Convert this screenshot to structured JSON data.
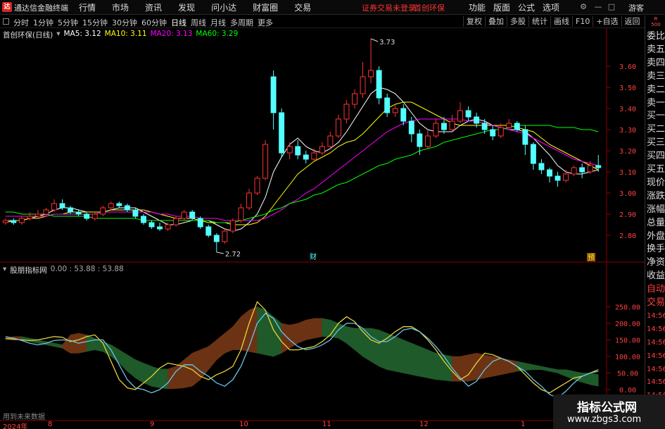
{
  "titlebar": {
    "app_name": "通达信金融终端",
    "menu": [
      "行情",
      "市场",
      "资讯",
      "发现",
      "问小达",
      "财富圈",
      "交易"
    ],
    "login_status": "证券交易未登录",
    "stock_name": "首创环保",
    "right_menu": [
      "功能",
      "版面",
      "公式",
      "选项"
    ],
    "guest": "游客"
  },
  "toolbar": {
    "periods": [
      "分时",
      "1分钟",
      "5分钟",
      "15分钟",
      "30分钟",
      "60分钟",
      "日线",
      "周线",
      "月线",
      "多周期",
      "更多"
    ],
    "active_period": "日线",
    "tools": [
      "复权",
      "叠加",
      "多股",
      "统计",
      "画线",
      "F10",
      "+自选",
      "返回"
    ]
  },
  "legend": {
    "title": "首创环保(日线)",
    "ma5": "MA5: 3.12",
    "ma10": "MA10: 3.11",
    "ma20": "MA20: 3.13",
    "ma60": "MA60: 3.29"
  },
  "indicator_legend": {
    "title": "股朋指标网",
    "values": "0.00 : 53.88 : 53.88"
  },
  "future_text": "用到未来数据",
  "price_axis": [
    "3.60",
    "3.50",
    "3.40",
    "3.30",
    "3.20",
    "3.10",
    "3.00",
    "2.90",
    "2.80"
  ],
  "indicator_axis": [
    "250.00",
    "200.00",
    "150.00",
    "100.00",
    "50.00",
    "0.00"
  ],
  "annotations": {
    "high": "3.73",
    "low": "2.72",
    "cai": "财",
    "yu": "预"
  },
  "date_axis": [
    "2024年",
    "8",
    "9",
    "10",
    "11",
    "12",
    "1"
  ],
  "sidebar": {
    "badge": "R\n500",
    "items": [
      "委比",
      "卖五",
      "卖四",
      "卖三",
      "卖二",
      "卖一",
      "买一",
      "买二",
      "买三",
      "买四",
      "买五",
      "现价",
      "涨跌",
      "涨幅",
      "总量",
      "外盘",
      "换手",
      "净资",
      "收益",
      "自动",
      "交易",
      "14:56",
      "14:56",
      "14:56",
      "14:56",
      "14:56",
      "14:56",
      "14:56",
      "14:56",
      "14:56"
    ]
  },
  "watermark": {
    "line1": "指标公式网",
    "line2": "www.zbgs3.com"
  },
  "colors": {
    "up": "#ff3232",
    "down": "#54ffff",
    "ma5": "#ffffff",
    "ma10": "#ffff00",
    "ma20": "#ff00ff",
    "ma60": "#00ff00",
    "band_up": "#6b3313",
    "band_down": "#1f5a2a",
    "line_yellow": "#e8d33a",
    "line_blue": "#6bc4e8"
  },
  "chart_data": [
    {
      "type": "candlestick",
      "title": "首创环保(日线)",
      "ylim": [
        2.72,
        3.73
      ],
      "y_ticks": [
        2.8,
        2.9,
        3.0,
        3.1,
        3.2,
        3.3,
        3.4,
        3.5,
        3.6
      ],
      "x_ticks": [
        "2024年",
        "8",
        "9",
        "10",
        "11",
        "12",
        "1"
      ],
      "candles": [
        [
          2.86,
          2.87,
          2.88,
          2.85
        ],
        [
          2.87,
          2.86,
          2.88,
          2.85
        ],
        [
          2.86,
          2.88,
          2.89,
          2.85
        ],
        [
          2.88,
          2.89,
          2.91,
          2.87
        ],
        [
          2.89,
          2.9,
          2.92,
          2.88
        ],
        [
          2.9,
          2.92,
          2.93,
          2.89
        ],
        [
          2.92,
          2.95,
          2.97,
          2.91
        ],
        [
          2.95,
          2.93,
          2.97,
          2.92
        ],
        [
          2.93,
          2.91,
          2.94,
          2.9
        ],
        [
          2.91,
          2.9,
          2.92,
          2.89
        ],
        [
          2.9,
          2.88,
          2.91,
          2.87
        ],
        [
          2.88,
          2.9,
          2.91,
          2.87
        ],
        [
          2.9,
          2.93,
          2.94,
          2.89
        ],
        [
          2.93,
          2.95,
          2.96,
          2.92
        ],
        [
          2.95,
          2.94,
          2.96,
          2.93
        ],
        [
          2.94,
          2.92,
          2.95,
          2.91
        ],
        [
          2.92,
          2.89,
          2.93,
          2.88
        ],
        [
          2.89,
          2.86,
          2.9,
          2.85
        ],
        [
          2.86,
          2.84,
          2.87,
          2.83
        ],
        [
          2.84,
          2.83,
          2.86,
          2.82
        ],
        [
          2.83,
          2.85,
          2.86,
          2.82
        ],
        [
          2.85,
          2.88,
          2.89,
          2.84
        ],
        [
          2.88,
          2.91,
          2.92,
          2.87
        ],
        [
          2.91,
          2.88,
          2.92,
          2.87
        ],
        [
          2.88,
          2.84,
          2.89,
          2.83
        ],
        [
          2.84,
          2.8,
          2.85,
          2.79
        ],
        [
          2.8,
          2.77,
          2.81,
          2.72
        ],
        [
          2.77,
          2.82,
          2.83,
          2.76
        ],
        [
          2.82,
          2.87,
          2.88,
          2.81
        ],
        [
          2.87,
          2.93,
          2.95,
          2.86
        ],
        [
          2.93,
          3.0,
          3.02,
          2.92
        ],
        [
          3.0,
          3.07,
          3.08,
          2.99
        ],
        [
          3.07,
          3.23,
          3.25,
          3.06
        ],
        [
          3.55,
          3.38,
          3.58,
          3.3
        ],
        [
          3.38,
          3.19,
          3.4,
          3.17
        ],
        [
          3.19,
          3.22,
          3.24,
          3.16
        ],
        [
          3.22,
          3.18,
          3.25,
          3.16
        ],
        [
          3.18,
          3.16,
          3.2,
          3.14
        ],
        [
          3.16,
          3.19,
          3.21,
          3.15
        ],
        [
          3.19,
          3.22,
          3.24,
          3.18
        ],
        [
          3.22,
          3.27,
          3.29,
          3.21
        ],
        [
          3.27,
          3.35,
          3.37,
          3.26
        ],
        [
          3.35,
          3.42,
          3.44,
          3.33
        ],
        [
          3.42,
          3.47,
          3.49,
          3.4
        ],
        [
          3.47,
          3.55,
          3.62,
          3.45
        ],
        [
          3.55,
          3.58,
          3.73,
          3.52
        ],
        [
          3.58,
          3.45,
          3.6,
          3.42
        ],
        [
          3.45,
          3.38,
          3.47,
          3.36
        ],
        [
          3.38,
          3.4,
          3.42,
          3.36
        ],
        [
          3.4,
          3.34,
          3.42,
          3.32
        ],
        [
          3.34,
          3.28,
          3.36,
          3.24
        ],
        [
          3.28,
          3.22,
          3.3,
          3.18
        ],
        [
          3.22,
          3.27,
          3.3,
          3.21
        ],
        [
          3.27,
          3.33,
          3.35,
          3.26
        ],
        [
          3.33,
          3.3,
          3.36,
          3.28
        ],
        [
          3.3,
          3.34,
          3.37,
          3.29
        ],
        [
          3.34,
          3.39,
          3.43,
          3.33
        ],
        [
          3.39,
          3.36,
          3.41,
          3.34
        ],
        [
          3.36,
          3.33,
          3.38,
          3.31
        ],
        [
          3.33,
          3.3,
          3.35,
          3.28
        ],
        [
          3.3,
          3.27,
          3.32,
          3.25
        ],
        [
          3.27,
          3.31,
          3.33,
          3.26
        ],
        [
          3.31,
          3.33,
          3.35,
          3.3
        ],
        [
          3.33,
          3.3,
          3.34,
          3.29
        ],
        [
          3.3,
          3.23,
          3.32,
          3.18
        ],
        [
          3.23,
          3.14,
          3.24,
          3.11
        ],
        [
          3.14,
          3.11,
          3.16,
          3.09
        ],
        [
          3.11,
          3.08,
          3.12,
          3.05
        ],
        [
          3.08,
          3.06,
          3.1,
          3.03
        ],
        [
          3.06,
          3.09,
          3.11,
          3.05
        ],
        [
          3.09,
          3.12,
          3.13,
          3.08
        ],
        [
          3.12,
          3.1,
          3.14,
          3.07
        ],
        [
          3.1,
          3.13,
          3.15,
          3.09
        ],
        [
          3.13,
          3.12,
          3.18,
          3.1
        ]
      ],
      "series": [
        {
          "name": "MA5",
          "values": [
            2.86,
            2.87,
            2.87,
            2.88,
            2.89,
            2.9,
            2.92,
            2.93,
            2.93,
            2.92,
            2.91,
            2.91,
            2.91,
            2.92,
            2.93,
            2.93,
            2.93,
            2.91,
            2.89,
            2.87,
            2.85,
            2.85,
            2.86,
            2.87,
            2.87,
            2.87,
            2.85,
            2.83,
            2.82,
            2.83,
            2.86,
            2.9,
            2.98,
            3.1,
            3.17,
            3.23,
            3.26,
            3.22,
            3.2,
            3.19,
            3.21,
            3.24,
            3.29,
            3.35,
            3.41,
            3.47,
            3.5,
            3.49,
            3.47,
            3.43,
            3.38,
            3.33,
            3.3,
            3.29,
            3.29,
            3.29,
            3.32,
            3.34,
            3.35,
            3.34,
            3.32,
            3.31,
            3.3,
            3.3,
            3.29,
            3.26,
            3.22,
            3.18,
            3.13,
            3.1,
            3.09,
            3.09,
            3.1,
            3.11
          ]
        },
        {
          "name": "MA10",
          "values": [
            2.87,
            2.87,
            2.87,
            2.88,
            2.88,
            2.89,
            2.9,
            2.9,
            2.91,
            2.91,
            2.91,
            2.91,
            2.91,
            2.92,
            2.92,
            2.92,
            2.92,
            2.92,
            2.91,
            2.9,
            2.89,
            2.88,
            2.88,
            2.88,
            2.87,
            2.86,
            2.86,
            2.86,
            2.85,
            2.85,
            2.85,
            2.86,
            2.89,
            2.94,
            2.99,
            3.04,
            3.09,
            3.12,
            3.15,
            3.17,
            3.19,
            3.22,
            3.24,
            3.25,
            3.28,
            3.32,
            3.36,
            3.4,
            3.42,
            3.43,
            3.43,
            3.41,
            3.39,
            3.37,
            3.35,
            3.33,
            3.32,
            3.32,
            3.32,
            3.32,
            3.32,
            3.32,
            3.32,
            3.31,
            3.3,
            3.29,
            3.26,
            3.23,
            3.21,
            3.19,
            3.17,
            3.15,
            3.13,
            3.11
          ]
        },
        {
          "name": "MA20",
          "values": [
            2.89,
            2.89,
            2.89,
            2.89,
            2.89,
            2.89,
            2.9,
            2.9,
            2.9,
            2.9,
            2.9,
            2.9,
            2.91,
            2.91,
            2.91,
            2.91,
            2.91,
            2.91,
            2.91,
            2.9,
            2.9,
            2.89,
            2.89,
            2.89,
            2.88,
            2.88,
            2.88,
            2.87,
            2.87,
            2.87,
            2.87,
            2.87,
            2.88,
            2.9,
            2.92,
            2.95,
            2.97,
            3.0,
            3.02,
            3.05,
            3.08,
            3.11,
            3.14,
            3.17,
            3.2,
            3.23,
            3.26,
            3.29,
            3.31,
            3.33,
            3.34,
            3.35,
            3.35,
            3.35,
            3.35,
            3.35,
            3.35,
            3.34,
            3.34,
            3.33,
            3.32,
            3.31,
            3.3,
            3.29,
            3.28,
            3.26,
            3.24,
            3.22,
            3.2,
            3.18,
            3.16,
            3.15,
            3.14,
            3.13
          ]
        },
        {
          "name": "MA60",
          "values": [
            2.91,
            2.91,
            2.9,
            2.9,
            2.9,
            2.9,
            2.89,
            2.89,
            2.89,
            2.89,
            2.89,
            2.88,
            2.88,
            2.88,
            2.88,
            2.88,
            2.88,
            2.87,
            2.87,
            2.87,
            2.87,
            2.87,
            2.87,
            2.87,
            2.87,
            2.87,
            2.86,
            2.86,
            2.86,
            2.87,
            2.88,
            2.89,
            2.9,
            2.92,
            2.93,
            2.95,
            2.96,
            2.97,
            2.99,
            3.0,
            3.02,
            3.04,
            3.05,
            3.07,
            3.09,
            3.11,
            3.13,
            3.14,
            3.16,
            3.17,
            3.18,
            3.2,
            3.21,
            3.22,
            3.24,
            3.25,
            3.26,
            3.27,
            3.28,
            3.29,
            3.3,
            3.3,
            3.31,
            3.32,
            3.32,
            3.32,
            3.32,
            3.32,
            3.31,
            3.31,
            3.31,
            3.3,
            3.3,
            3.29
          ]
        }
      ]
    },
    {
      "type": "line",
      "title": "股朋指标网",
      "ylim": [
        -30,
        280
      ],
      "y_ticks": [
        0,
        50,
        100,
        150,
        200,
        250
      ],
      "series": [
        {
          "name": "yellow",
          "values": [
            155,
            152,
            150,
            148,
            150,
            155,
            160,
            158,
            145,
            150,
            160,
            165,
            140,
            85,
            30,
            5,
            0,
            20,
            40,
            65,
            80,
            75,
            70,
            60,
            40,
            30,
            45,
            55,
            70,
            120,
            200,
            265,
            240,
            180,
            145,
            120,
            120,
            125,
            130,
            145,
            165,
            200,
            220,
            205,
            175,
            150,
            140,
            155,
            175,
            190,
            190,
            175,
            150,
            120,
            85,
            55,
            30,
            45,
            80,
            110,
            105,
            95,
            85,
            70,
            45,
            20,
            0,
            -10,
            5,
            20,
            35,
            40,
            50,
            60
          ]
        },
        {
          "name": "blue",
          "values": [
            160,
            155,
            148,
            140,
            135,
            140,
            148,
            150,
            148,
            140,
            145,
            150,
            150,
            120,
            75,
            30,
            5,
            0,
            -10,
            0,
            20,
            55,
            75,
            75,
            55,
            40,
            20,
            10,
            30,
            70,
            130,
            200,
            230,
            215,
            175,
            150,
            130,
            120,
            125,
            135,
            150,
            180,
            200,
            200,
            185,
            160,
            145,
            145,
            160,
            180,
            185,
            175,
            155,
            130,
            100,
            65,
            35,
            10,
            25,
            60,
            85,
            95,
            85,
            70,
            55,
            30,
            10,
            -15,
            -25,
            -5,
            20,
            40,
            50,
            55
          ]
        },
        {
          "name": "band_top",
          "values": [
            155,
            160,
            160,
            155,
            150,
            145,
            140,
            135,
            165,
            170,
            165,
            155,
            145,
            135,
            120,
            105,
            90,
            80,
            70,
            62,
            62,
            70,
            90,
            110,
            120,
            130,
            150,
            170,
            190,
            220,
            240,
            250,
            240,
            220,
            200,
            195,
            200,
            210,
            215,
            215,
            210,
            200,
            190,
            185,
            185,
            185,
            180,
            170,
            160,
            150,
            140,
            130,
            120,
            110,
            105,
            100,
            100,
            105,
            110,
            105,
            100,
            95,
            90,
            85,
            80,
            75,
            70,
            65,
            60,
            60,
            55,
            50,
            50,
            45
          ]
        },
        {
          "name": "band_bot",
          "values": [
            150,
            150,
            150,
            145,
            140,
            135,
            130,
            125,
            110,
            110,
            115,
            120,
            115,
            100,
            80,
            55,
            35,
            20,
            10,
            5,
            2,
            3,
            5,
            10,
            30,
            60,
            90,
            110,
            120,
            120,
            115,
            110,
            105,
            100,
            110,
            125,
            140,
            150,
            155,
            160,
            160,
            155,
            140,
            120,
            100,
            85,
            70,
            60,
            55,
            50,
            45,
            40,
            35,
            30,
            28,
            25,
            25,
            25,
            30,
            35,
            40,
            45,
            50,
            55,
            58,
            60,
            60,
            55,
            50,
            40,
            30,
            22,
            15,
            10
          ]
        }
      ]
    }
  ]
}
